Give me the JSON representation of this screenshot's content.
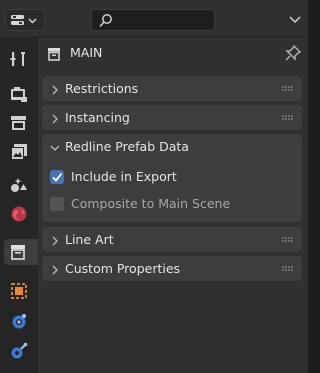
{
  "context": {
    "title": "MAIN",
    "icon": "collection-icon"
  },
  "panels": [
    {
      "label": "Restrictions",
      "expanded": false
    },
    {
      "label": "Instancing",
      "expanded": false
    },
    {
      "label": "Redline Prefab Data",
      "expanded": true
    },
    {
      "label": "Line Art",
      "expanded": false
    },
    {
      "label": "Custom Properties",
      "expanded": false
    }
  ],
  "redline": {
    "include_label": "Include in Export",
    "include_checked": true,
    "composite_label": "Composite to Main Scene",
    "composite_checked": false
  },
  "tabs": [
    "tool-icon",
    "render-icon",
    "output-icon",
    "view-layer-icon",
    "scene-icon",
    "world-icon",
    "collection-icon",
    "object-icon",
    "physics-icon",
    "constraints-icon"
  ],
  "active_tab": "collection-icon",
  "colors": {
    "accent": "#4772b3",
    "panel": "#3d3d3d",
    "background": "#303030"
  }
}
